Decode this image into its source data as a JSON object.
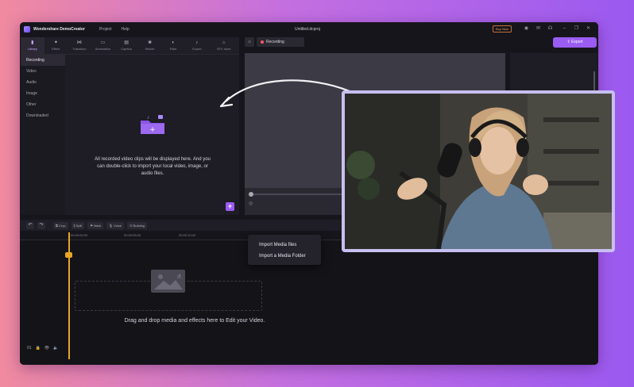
{
  "titlebar": {
    "app_name": "Wondershare DemoCreator",
    "menu": [
      "Project",
      "Help"
    ],
    "document_title": "Untitled.dcproj",
    "buy_now": "Buy Now"
  },
  "library": {
    "tabs": [
      {
        "label": "Library",
        "icon": "library-icon",
        "glyph": "▮"
      },
      {
        "label": "Effect",
        "icon": "effect-icon",
        "glyph": "✦"
      },
      {
        "label": "Transition",
        "icon": "transition-icon",
        "glyph": "⋈"
      },
      {
        "label": "Annotation",
        "icon": "annotation-icon",
        "glyph": "▭"
      },
      {
        "label": "Caption",
        "icon": "caption-icon",
        "glyph": "▤"
      },
      {
        "label": "Sticker",
        "icon": "sticker-icon",
        "glyph": "❀"
      },
      {
        "label": "Filter",
        "icon": "filter-icon",
        "glyph": "◐"
      },
      {
        "label": "Sound",
        "icon": "sound-icon",
        "glyph": "♪"
      },
      {
        "label": "SFX store",
        "icon": "store-icon",
        "glyph": "⌂"
      }
    ],
    "sidebar": [
      "Recording",
      "Video",
      "Audio",
      "Image",
      "Other",
      "Downloaded"
    ],
    "empty_text": "All recorded video clips will be displayed here. And you can double-click to import your local video, image, or audio files."
  },
  "context_menu": [
    "Import Media files",
    "Import a Media Folder"
  ],
  "preview": {
    "recording_chip": "Recording",
    "export_label": "Export"
  },
  "timeline": {
    "tools": [
      "Crop",
      "Split",
      "Mark",
      "Voice",
      "Building"
    ],
    "ruler": [
      "00:00:00:00",
      "00:00:05:00",
      "00:00:10:00"
    ],
    "drop_text": "Drag and drop media and effects here to Edit your Video.",
    "track_number": "01"
  },
  "colors": {
    "accent": "#9a5cf2",
    "playhead": "#e8a623",
    "window_bg": "#17151c"
  }
}
